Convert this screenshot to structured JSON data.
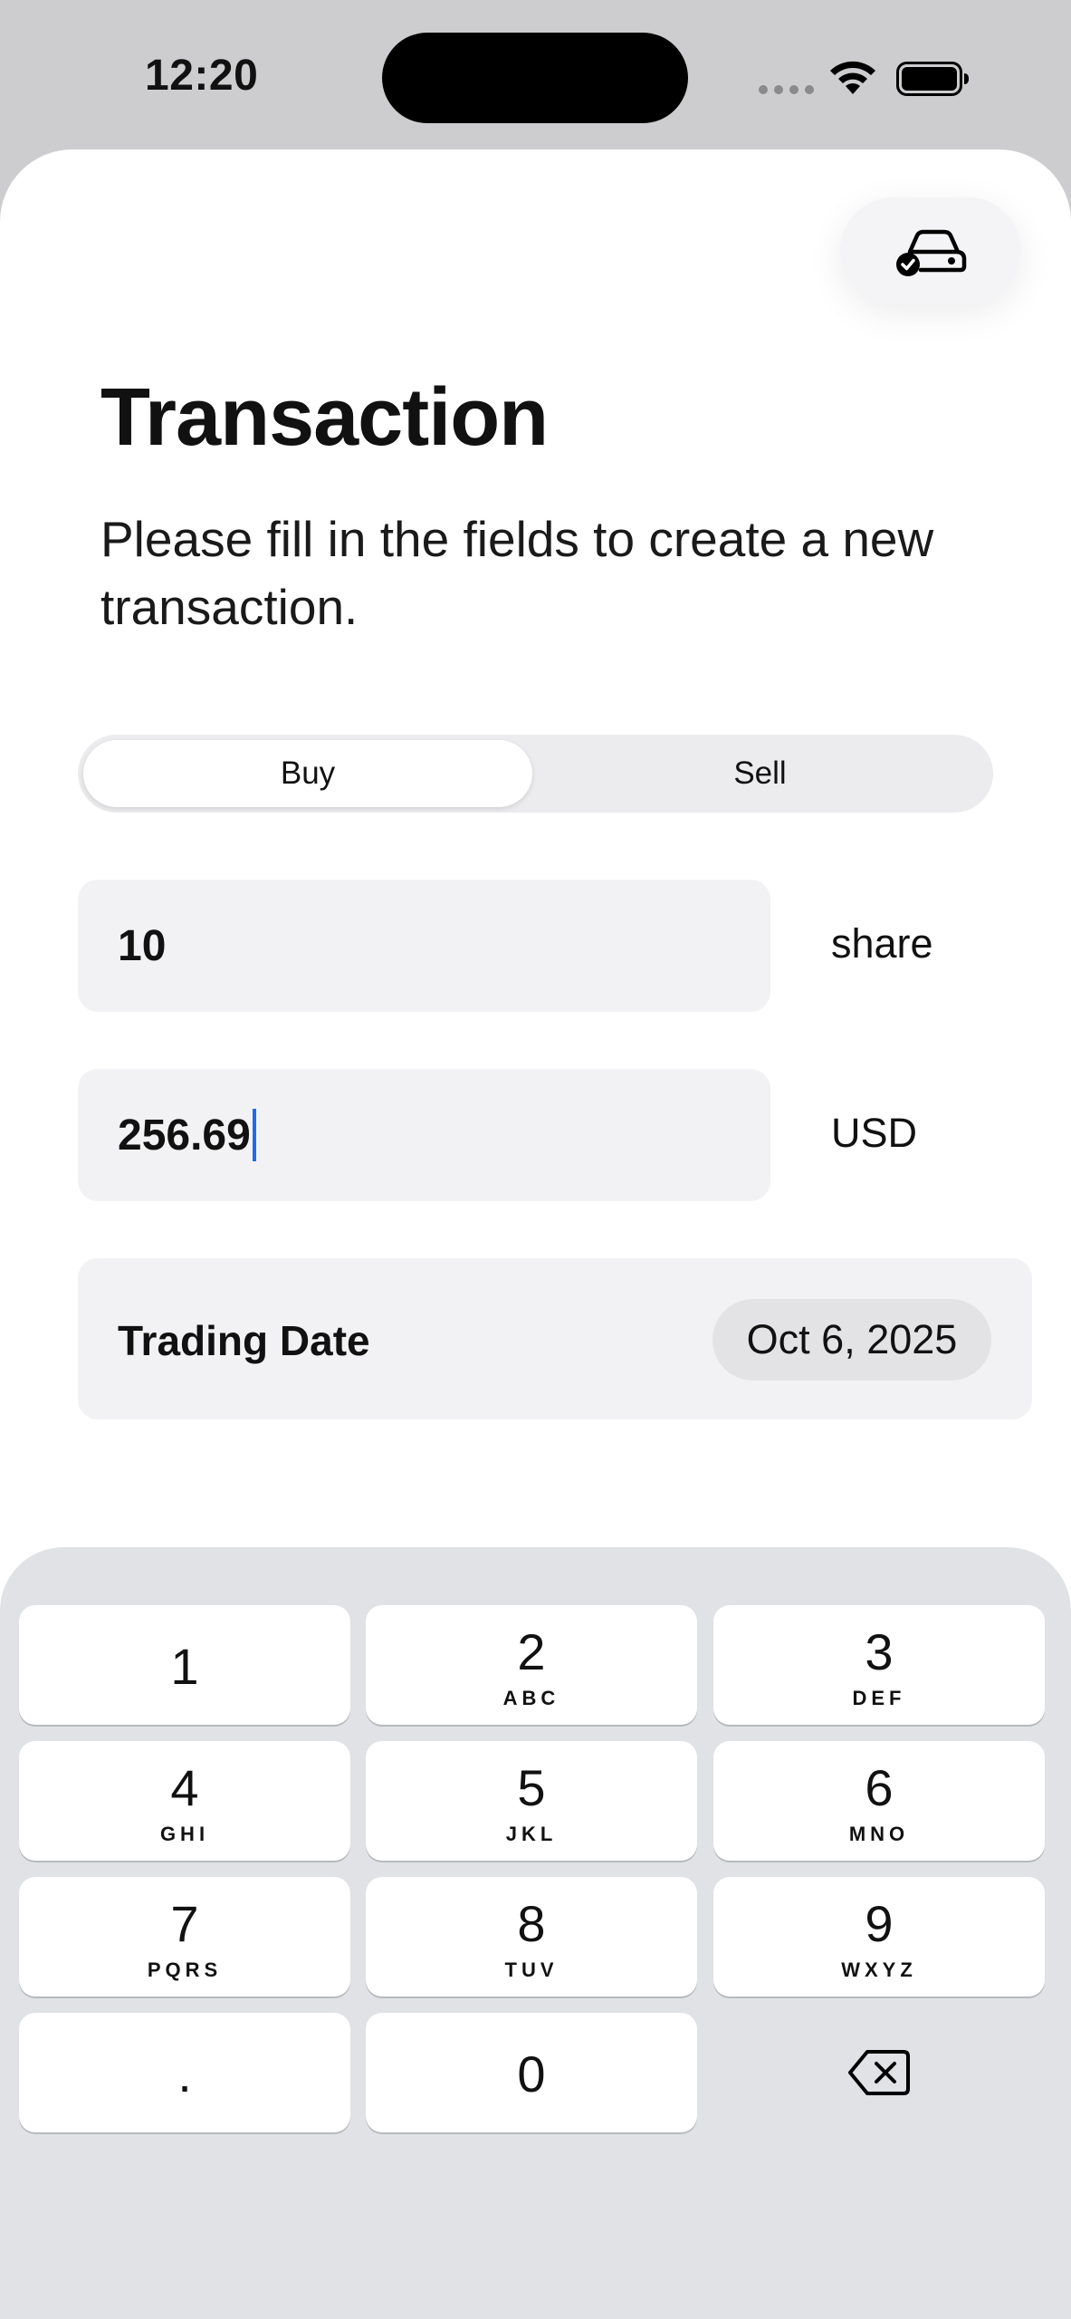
{
  "status_bar": {
    "time": "12:20"
  },
  "header": {
    "title": "Transaction",
    "subtitle": "Please fill in the fields to create a new transaction.",
    "top_action_icon": "car-check-icon"
  },
  "segmented": {
    "options": [
      "Buy",
      "Sell"
    ],
    "selected": "Buy"
  },
  "form": {
    "quantity": {
      "value": "10",
      "unit": "share"
    },
    "price": {
      "value": "256.69",
      "unit": "USD"
    },
    "trading_date": {
      "label": "Trading Date",
      "value": "Oct 6, 2025"
    }
  },
  "keyboard": {
    "keys": [
      {
        "num": "1",
        "letters": ""
      },
      {
        "num": "2",
        "letters": "ABC"
      },
      {
        "num": "3",
        "letters": "DEF"
      },
      {
        "num": "4",
        "letters": "GHI"
      },
      {
        "num": "5",
        "letters": "JKL"
      },
      {
        "num": "6",
        "letters": "MNO"
      },
      {
        "num": "7",
        "letters": "PQRS"
      },
      {
        "num": "8",
        "letters": "TUV"
      },
      {
        "num": "9",
        "letters": "WXYZ"
      },
      {
        "num": ".",
        "letters": ""
      },
      {
        "num": "0",
        "letters": ""
      }
    ],
    "delete_icon": "delete-backspace-icon"
  },
  "colors": {
    "caret": "#1e6bf0",
    "field_bg": "#f2f2f4",
    "keyboard_bg": "#e1e2e6"
  }
}
